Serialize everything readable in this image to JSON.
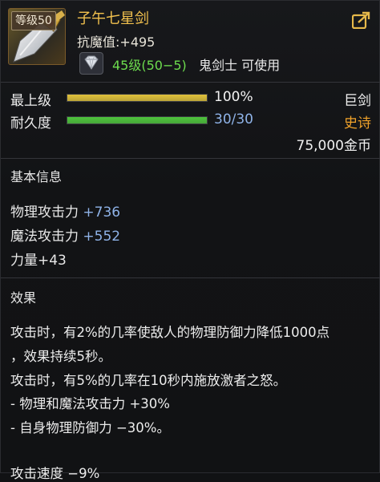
{
  "item": {
    "level_badge": "等级50",
    "name": "子午七星剑",
    "resist_label": "抗魔值:",
    "resist_value": "+495",
    "requirement_level": "45级(50−5)",
    "requirement_class": "鬼剑士 可使用",
    "icon": "sword-icon",
    "gem_icon": "diamond-icon",
    "share_icon": "share-icon"
  },
  "bars": {
    "upgrade": {
      "label": "最上级",
      "value": "100%",
      "fraction": 1.0,
      "color": "#e0c23a",
      "value_color": "#f2f2f2"
    },
    "durability": {
      "label": "耐久度",
      "value": "30/30",
      "fraction": 1.0,
      "color": "#4ec53c",
      "value_color": "#8fb3e8"
    }
  },
  "type": {
    "weapon_type": "巨剑",
    "rarity": "史诗",
    "rarity_color": "#f0a22a"
  },
  "price": "75,000金币",
  "basic": {
    "title": "基本信息",
    "stats": [
      {
        "name": "物理攻击力",
        "value": "+736"
      },
      {
        "name": "魔法攻击力",
        "value": "+552"
      },
      {
        "name": "力量",
        "value": "+43"
      }
    ]
  },
  "effects": {
    "title": "效果",
    "lines": [
      "攻击时，有2%的几率使敌人的物理防御力降低1000点",
      "，效果持续5秒。",
      "攻击时，有5%的几率在10秒内施放激者之怒。",
      " - 物理和魔法攻击力 +30%",
      " - 自身物理防御力 −30%。",
      "攻击速度 −9%"
    ]
  }
}
